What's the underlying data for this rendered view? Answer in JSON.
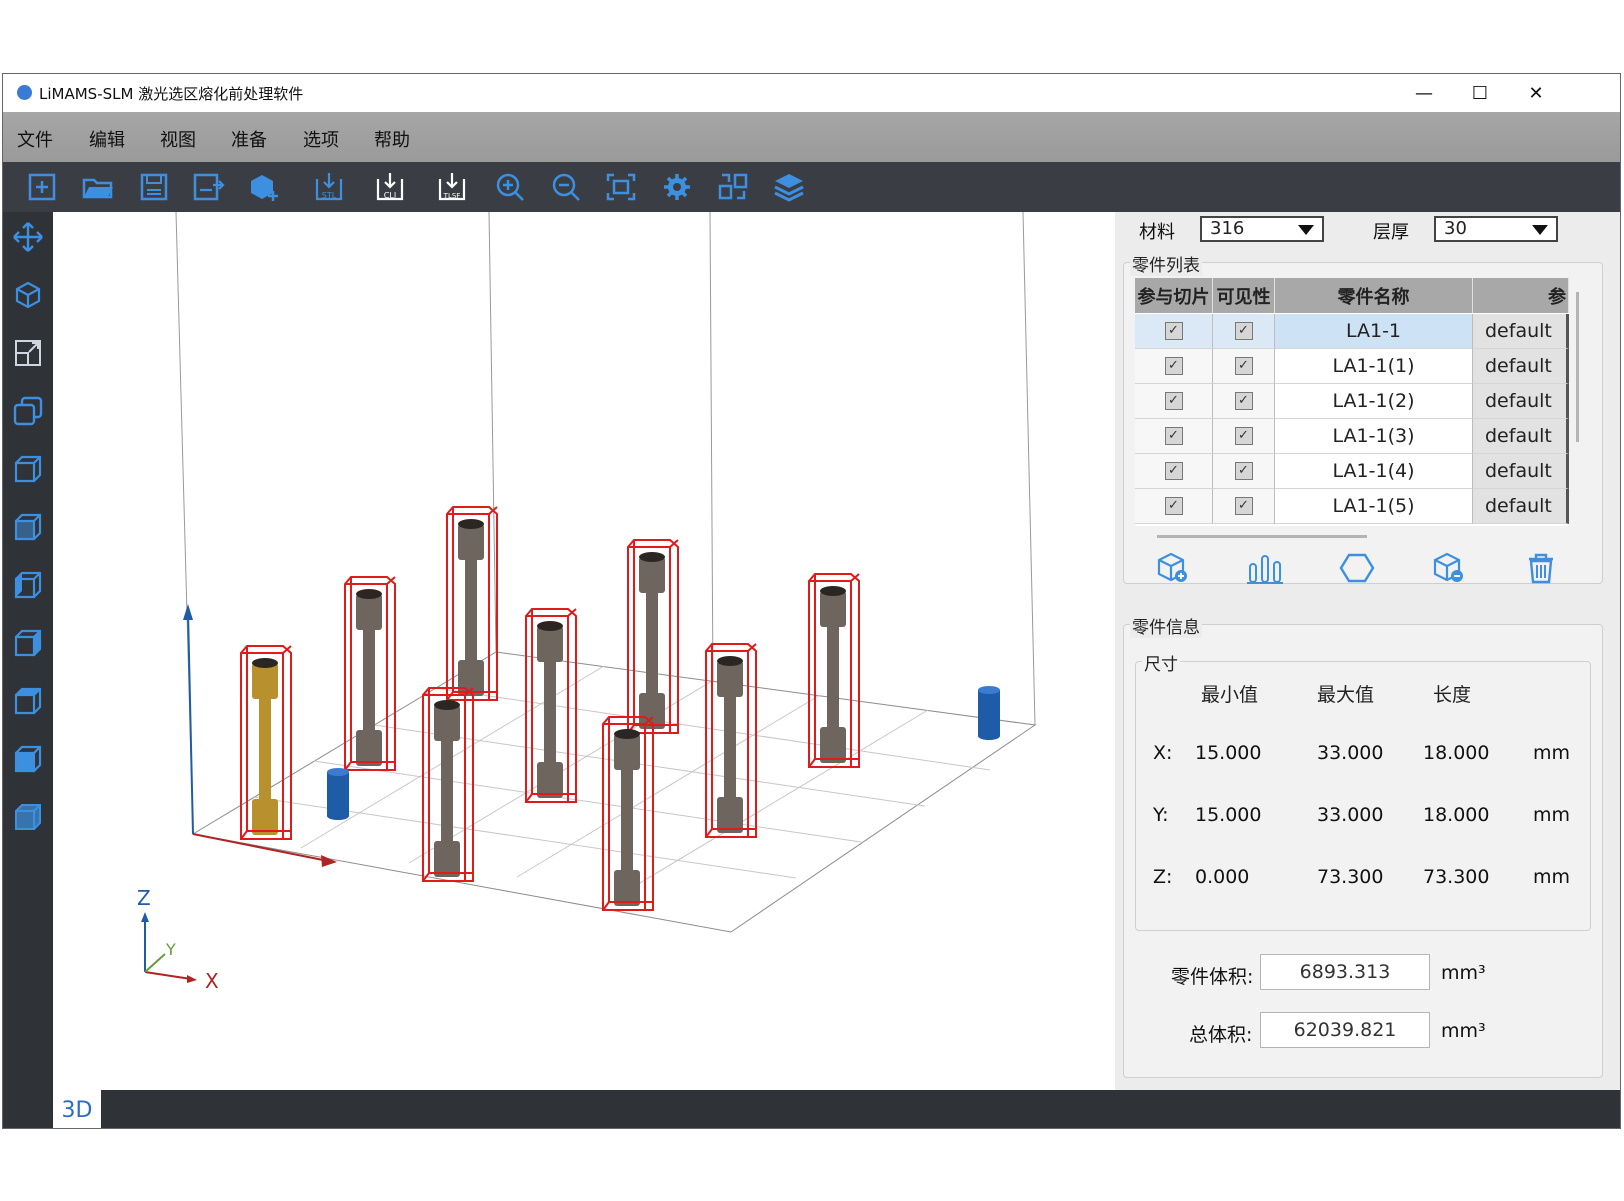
{
  "app": {
    "title": "LiMAMS-SLM 激光选区熔化前处理软件"
  },
  "window_controls": {
    "minimize": "—",
    "maximize": "☐",
    "close": "✕"
  },
  "menu": [
    "文件",
    "编辑",
    "视图",
    "准备",
    "选项",
    "帮助"
  ],
  "toolbar": {
    "icons": [
      "new-icon",
      "open-folder-icon",
      "save-icon",
      "save-as-icon",
      "add-part-icon",
      "export-stl-icon",
      "export-cli-icon",
      "export-tlsf-icon",
      "zoom-in-icon",
      "zoom-out-icon",
      "fit-view-icon",
      "settings-icon",
      "layout-icon",
      "layers-icon"
    ],
    "stl_label": "STL",
    "cli_label": "CLI",
    "tlsf_label": "TLSF"
  },
  "left_toolbar": {
    "icons": [
      "move-icon",
      "rotate-cube-icon",
      "scale-icon",
      "copy-icon",
      "view-front-icon",
      "view-back-icon",
      "view-left-icon",
      "view-right-icon",
      "view-top-icon",
      "view-bottom-icon",
      "view-iso-icon"
    ]
  },
  "viewport": {
    "axes": {
      "z": "Z",
      "y": "Y",
      "x": "X"
    },
    "tab": "3D"
  },
  "settings": {
    "material_label": "材料",
    "material_value": "316",
    "layer_label": "层厚",
    "layer_value": "30"
  },
  "parts_list": {
    "title": "零件列表",
    "headers": [
      "参与切片",
      "可见性",
      "零件名称",
      "参"
    ],
    "rows": [
      {
        "slice": "✓",
        "visible": "✓",
        "name": "LA1-1",
        "param": "default",
        "selected": true
      },
      {
        "slice": "✓",
        "visible": "✓",
        "name": "LA1-1(1)",
        "param": "default"
      },
      {
        "slice": "✓",
        "visible": "✓",
        "name": "LA1-1(2)",
        "param": "default"
      },
      {
        "slice": "✓",
        "visible": "✓",
        "name": "LA1-1(3)",
        "param": "default"
      },
      {
        "slice": "✓",
        "visible": "✓",
        "name": "LA1-1(4)",
        "param": "default"
      },
      {
        "slice": "✓",
        "visible": "✓",
        "name": "LA1-1(5)",
        "param": "default"
      }
    ],
    "actions": [
      "add-part-icon",
      "support-icon",
      "hexagon-icon",
      "remove-part-icon",
      "trash-icon"
    ]
  },
  "part_info": {
    "title": "零件信息",
    "size_title": "尺寸",
    "headers": [
      "最小值",
      "最大值",
      "长度"
    ],
    "rows": [
      {
        "axis": "X:",
        "min": "15.000",
        "max": "33.000",
        "len": "18.000",
        "unit": "mm"
      },
      {
        "axis": "Y:",
        "min": "15.000",
        "max": "33.000",
        "len": "18.000",
        "unit": "mm"
      },
      {
        "axis": "Z:",
        "min": "0.000",
        "max": "73.300",
        "len": "73.300",
        "unit": "mm"
      }
    ],
    "part_volume_label": "零件体积:",
    "part_volume": "6893.313",
    "part_volume_unit": "mm³",
    "total_volume_label": "总体积:",
    "total_volume": "62039.821",
    "total_volume_unit": "mm³"
  },
  "colors": {
    "accent": "#2b6cc4",
    "selection": "#cde3f5",
    "bbox": "#e01b1b",
    "toolbar": "#3a3e44",
    "part": "#6e655e",
    "selected_part": "#b8902e",
    "cylinder": "#1f5ca8"
  }
}
